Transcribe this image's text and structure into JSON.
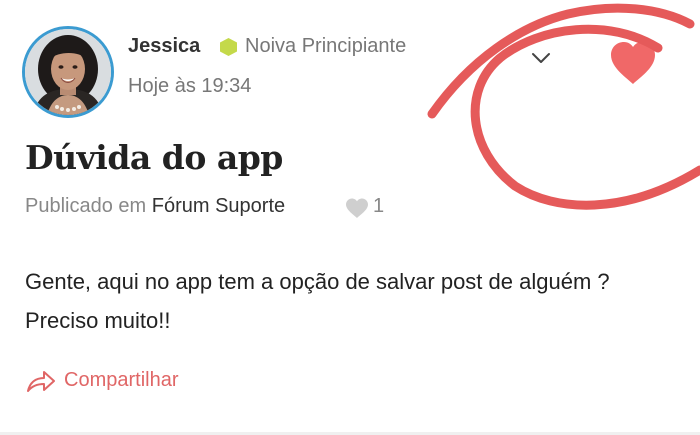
{
  "post": {
    "author": {
      "name": "Jessica",
      "rank": "Noiva Principiante",
      "timestamp": "Hoje às 19:34",
      "rank_color": "#c4d94a"
    },
    "title": "Dúvida do app",
    "meta": {
      "published_in_label": "Publicado em",
      "forum": "Fórum Suporte",
      "likes": "1"
    },
    "body": "Gente, aqui no app tem a opção de salvar post de alguém ? Preciso muito!!",
    "share_label": "Compartilhar"
  },
  "colors": {
    "accent": "#e06666",
    "favorite_heart": "#f06868",
    "annotation_circle": "#e55a5a",
    "avatar_border": "#3b9bd1"
  },
  "icons": {
    "rank": "hexagon-icon",
    "menu": "chevron-down-icon",
    "favorite": "heart-icon",
    "likes": "heart-icon",
    "share": "share-arrow-icon"
  }
}
